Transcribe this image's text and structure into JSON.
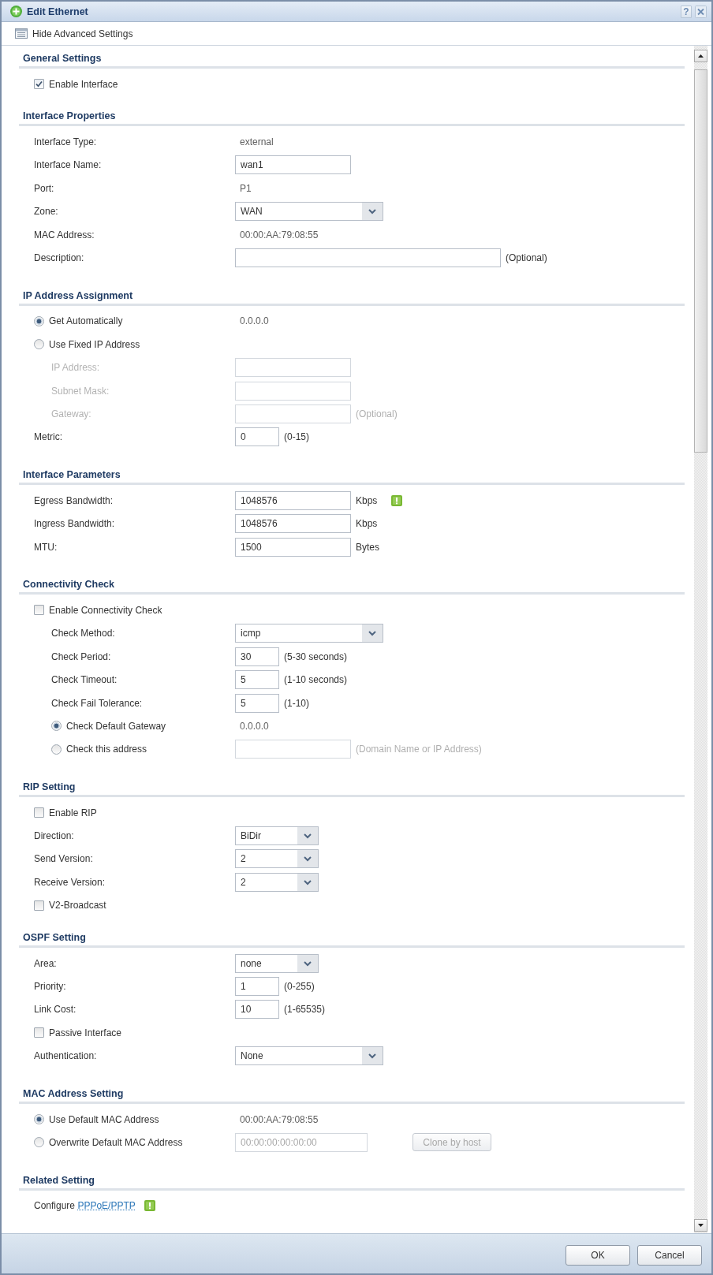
{
  "window": {
    "title": "Edit Ethernet",
    "help": "?"
  },
  "toolbar": {
    "label": "Hide Advanced Settings"
  },
  "sections": [
    {
      "title": "General Settings",
      "rows": [
        {
          "kind": "checkbox",
          "label": "Enable Interface",
          "checked": true
        }
      ]
    },
    {
      "title": "Interface Properties",
      "rows": [
        {
          "kind": "value",
          "label": "Interface Type:",
          "value": "external"
        },
        {
          "kind": "input",
          "label": "Interface Name:",
          "value": "wan1"
        },
        {
          "kind": "value",
          "label": "Port:",
          "value": "P1"
        },
        {
          "kind": "select",
          "label": "Zone:",
          "value": "WAN"
        },
        {
          "kind": "value",
          "label": "MAC Address:",
          "value": "00:00:AA:79:08:55"
        },
        {
          "kind": "long_input",
          "label": "Description:",
          "hint": "(Optional)"
        }
      ]
    },
    {
      "title": "IP Address Assignment",
      "rows": [
        {
          "kind": "radio",
          "label": "Get Automatically",
          "selected": true,
          "value": "0.0.0.0"
        },
        {
          "kind": "radio",
          "label": "Use Fixed IP Address",
          "selected": false,
          "children": [
            {
              "kind": "input",
              "label": "IP Address:",
              "disabled": true
            },
            {
              "kind": "input",
              "label": "Subnet Mask:",
              "disabled": true
            },
            {
              "kind": "input",
              "label": "Gateway:",
              "disabled": true,
              "hint": "(Optional)"
            }
          ]
        },
        {
          "kind": "short_input",
          "label": "Metric:",
          "value": "0",
          "hint": "(0-15)"
        }
      ]
    },
    {
      "title": "Interface Parameters",
      "rows": [
        {
          "kind": "input",
          "label": "Egress Bandwidth:",
          "value": "1048576",
          "unit": "Kbps",
          "info": true
        },
        {
          "kind": "input",
          "label": "Ingress Bandwidth:",
          "value": "1048576",
          "unit": "Kbps"
        },
        {
          "kind": "input",
          "label": "MTU:",
          "value": "1500",
          "unit": "Bytes"
        }
      ]
    },
    {
      "title": "Connectivity Check",
      "rows": [
        {
          "kind": "checkbox",
          "label": "Enable Connectivity Check",
          "checked": false,
          "children": [
            {
              "kind": "select",
              "label": "Check Method:",
              "value": "icmp"
            },
            {
              "kind": "short_input",
              "label": "Check Period:",
              "value": "30",
              "hint": "(5-30 seconds)"
            },
            {
              "kind": "short_input",
              "label": "Check Timeout:",
              "value": "5",
              "hint": "(1-10 seconds)"
            },
            {
              "kind": "short_input",
              "label": "Check Fail Tolerance:",
              "value": "5",
              "hint": "(1-10)"
            },
            {
              "kind": "radio",
              "label": "Check Default Gateway",
              "selected": true,
              "value": "0.0.0.0"
            },
            {
              "kind": "radio",
              "label": "Check this address",
              "selected": false,
              "field": {
                "kind": "input",
                "disabled": true
              },
              "hint": "(Domain Name or IP Address)"
            }
          ]
        }
      ]
    },
    {
      "title": "RIP Setting",
      "rows": [
        {
          "kind": "checkbox",
          "label": "Enable RIP",
          "checked": false
        },
        {
          "kind": "short_select",
          "label": "Direction:",
          "value": "BiDir"
        },
        {
          "kind": "short_select",
          "label": "Send Version:",
          "value": "2"
        },
        {
          "kind": "short_select",
          "label": "Receive Version:",
          "value": "2"
        },
        {
          "kind": "checkbox",
          "label": "V2-Broadcast",
          "checked": false
        }
      ]
    },
    {
      "title": "OSPF Setting",
      "rows": [
        {
          "kind": "short_select",
          "label": "Area:",
          "value": "none"
        },
        {
          "kind": "short_input",
          "label": "Priority:",
          "value": "1",
          "hint": "(0-255)"
        },
        {
          "kind": "short_input",
          "label": "Link Cost:",
          "value": "10",
          "hint": "(1-65535)"
        },
        {
          "kind": "checkbox",
          "label": "Passive Interface",
          "checked": false
        },
        {
          "kind": "select",
          "label": "Authentication:",
          "value": "None"
        }
      ]
    },
    {
      "title": "MAC Address Setting",
      "rows": [
        {
          "kind": "radio",
          "label": "Use Default MAC Address",
          "selected": true,
          "value": "00:00:AA:79:08:55"
        },
        {
          "kind": "radio",
          "label": "Overwrite Default MAC Address",
          "selected": false,
          "field": {
            "kind": "mac_input",
            "value": "00:00:00:00:00:00",
            "disabled": true
          },
          "button": {
            "label": "Clone by host",
            "disabled": true
          }
        }
      ]
    },
    {
      "title": "Related Setting",
      "rows": [
        {
          "kind": "link",
          "text": "Configure",
          "link": "PPPoE/PPTP",
          "info": true
        }
      ]
    }
  ],
  "footer": {
    "buttons": [
      "OK",
      "Cancel"
    ]
  }
}
